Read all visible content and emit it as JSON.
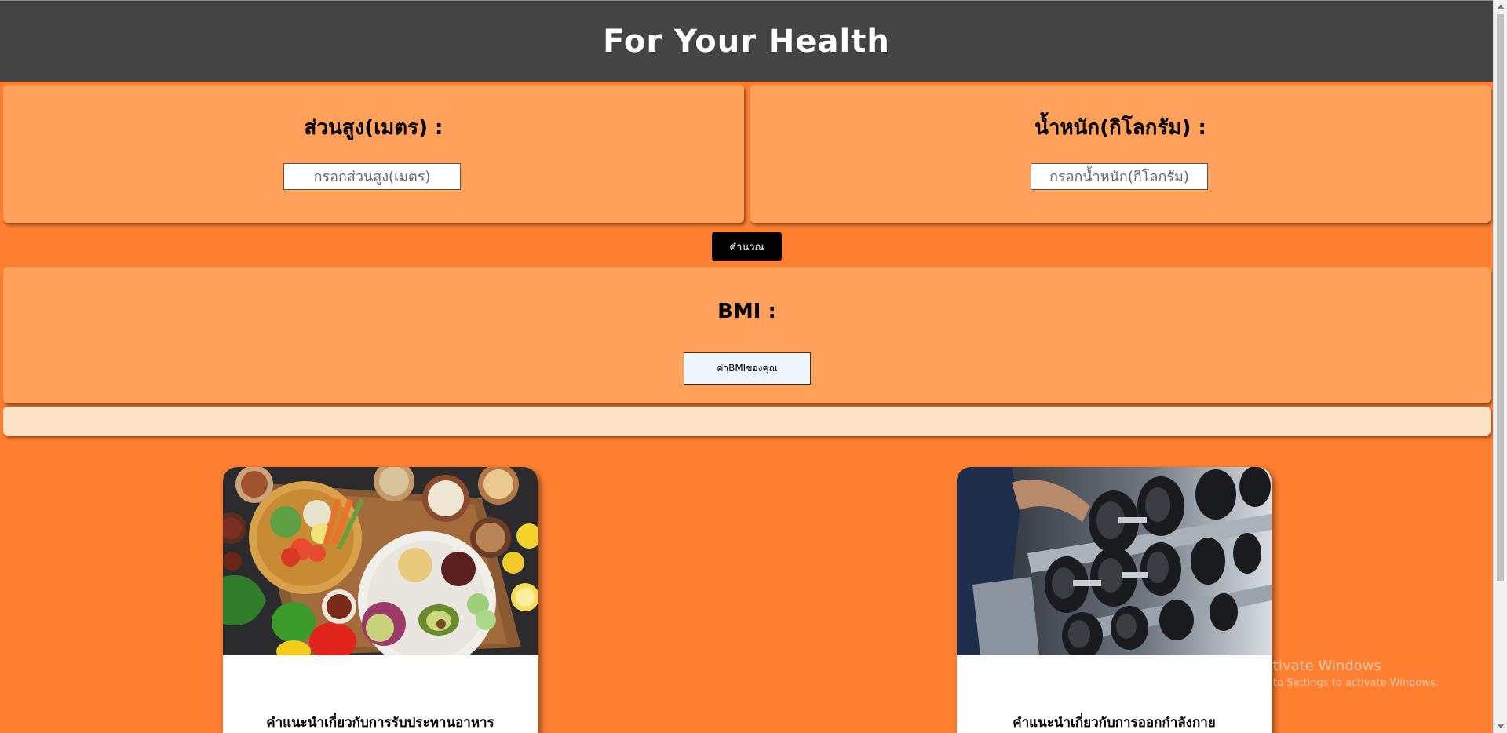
{
  "header": {
    "title": "For Your Health"
  },
  "height_panel": {
    "label": "ส่วนสูง(เมตร) :",
    "placeholder": "กรอกส่วนสูง(เมตร)"
  },
  "weight_panel": {
    "label": "น้ำหนัก(กิโลกรัม) :",
    "placeholder": "กรอกน้ำหนัก(กิโลกรัม)"
  },
  "calculate_button": {
    "label": "คำนวณ"
  },
  "bmi_panel": {
    "label": "BMI :",
    "value": "ค่าBMIของคุณ"
  },
  "result_bar": {
    "text": ""
  },
  "cards": [
    {
      "title": "คำแนะนำเกี่ยวกับการรับประทานอาหาร",
      "image": "healthy-food-photo"
    },
    {
      "title": "คำแนะนำเกี่ยวกับการออกกำลังกาย",
      "image": "dumbbell-rack-photo"
    }
  ],
  "watermark": {
    "line1": "Activate Windows",
    "line2": "Go to Settings to activate Windows."
  },
  "colors": {
    "page_bg": "#ff7f31",
    "header_bg": "#444444",
    "panel_bg": "#ffa15a",
    "result_bar_bg": "#ffe3c6",
    "button_bg": "#000000"
  }
}
